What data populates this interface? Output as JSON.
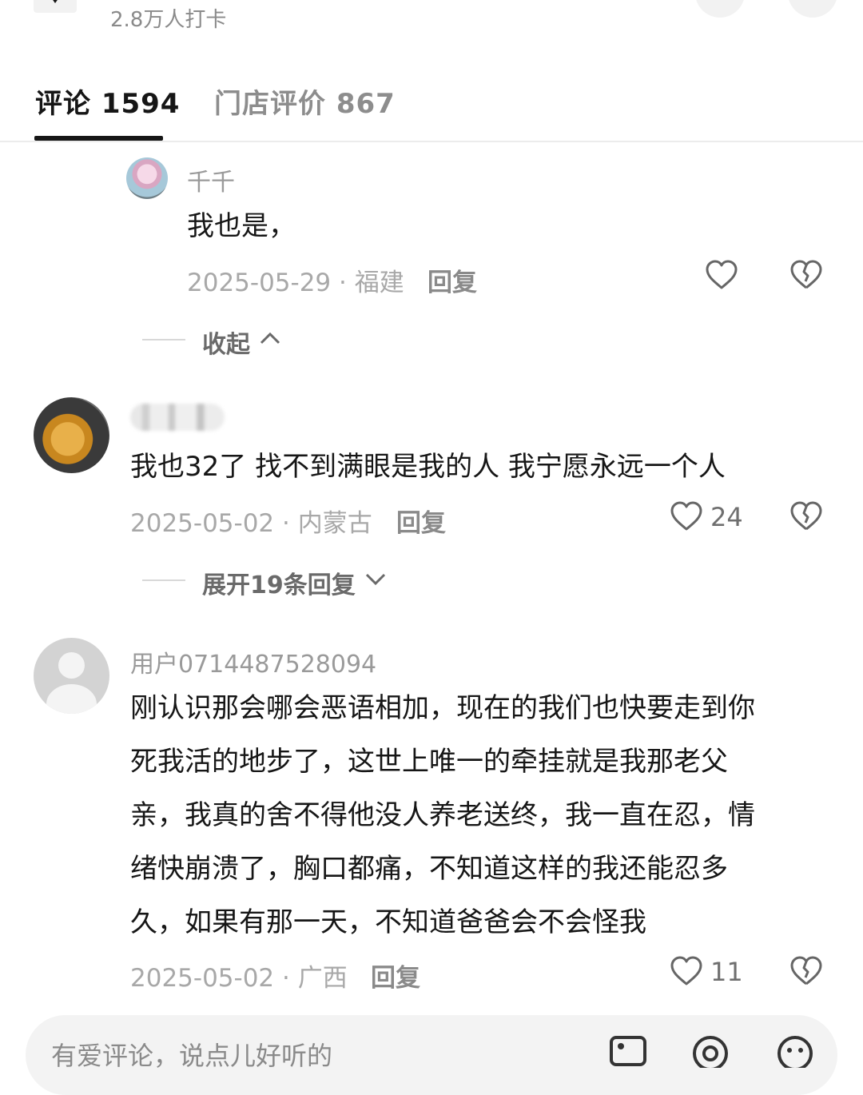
{
  "header": {
    "checkin_text": "2.8万人打卡"
  },
  "tabs": [
    {
      "label": "评论 1594"
    },
    {
      "label": "门店评价 867"
    }
  ],
  "reply_comment": {
    "username": "千千",
    "text": "我也是，",
    "date_location": "2025-05-29 · 福建",
    "reply_label": "回复",
    "collapse_label": "收起"
  },
  "comments": [
    {
      "username": "",
      "text": "我也32了  找不到满眼是我的人  我宁愿永远一个人",
      "date_location": "2025-05-02 · 内蒙古",
      "reply_label": "回复",
      "likes": "24",
      "expand_label": "展开19条回复"
    },
    {
      "username": "用户0714487528094",
      "text_lines": [
        "刚认识那会哪会恶语相加，现在的我们也快要走到你",
        "死我活的地步了，这世上唯一的牵挂就是我那老父",
        "亲，我真的舍不得他没人养老送终，我一直在忍，情",
        "绪快崩溃了，胸口都痛，不知道这样的我还能忍多",
        "久，如果有那一天，不知道爸爸会不会怪我"
      ],
      "date_location": "2025-05-02 · 广西",
      "reply_label": "回复",
      "likes": "11"
    }
  ],
  "input": {
    "placeholder": "有爱评论，说点儿好听的"
  },
  "icons": {
    "location": "location-pin-icon",
    "like": "heart-icon",
    "dislike": "broken-heart-icon",
    "image": "image-icon",
    "mention": "at-icon",
    "emoji": "emoji-icon",
    "chevron_up": "chevron-up-icon",
    "chevron_down": "chevron-down-icon"
  },
  "colors": {
    "primary_text": "#161616",
    "secondary_text": "#9a9a9a",
    "background": "#ffffff"
  }
}
